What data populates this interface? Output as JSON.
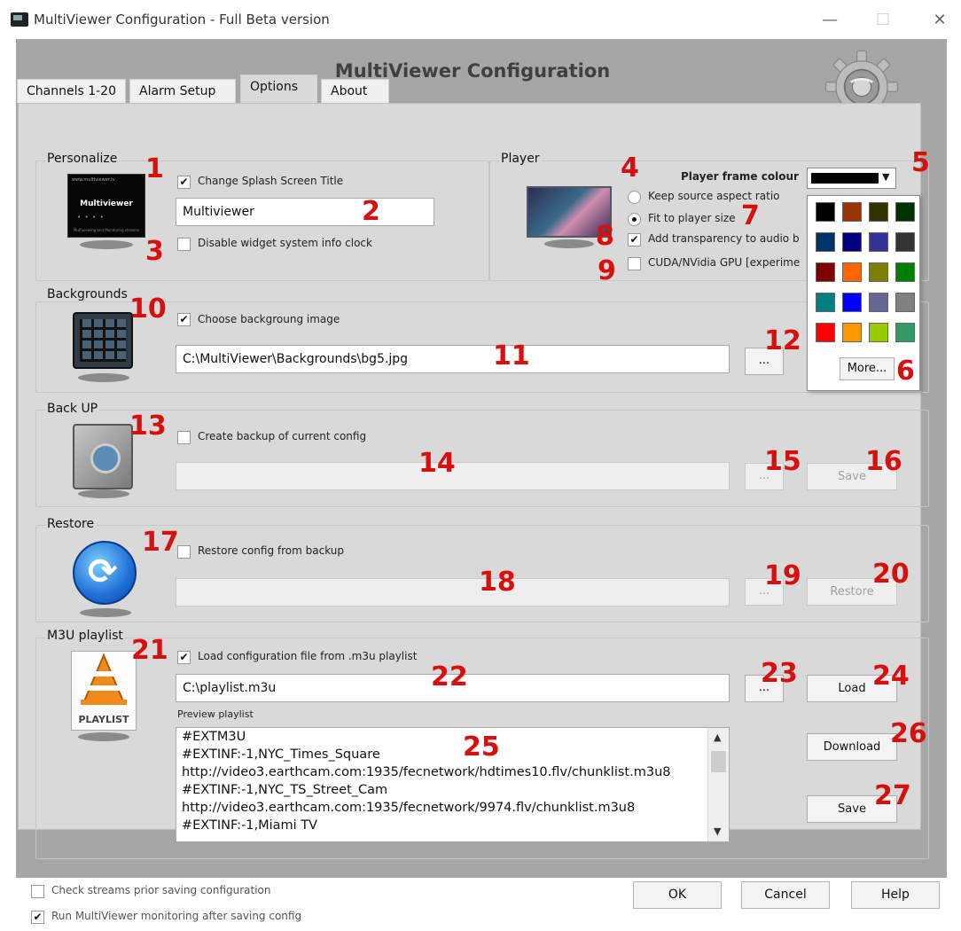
{
  "window": {
    "title": "MultiViewer Configuration - Full Beta version",
    "minimize_glyph": "—",
    "maximize_glyph": "☐",
    "close_glyph": "✕"
  },
  "header": {
    "title": "MultiViewer Configuration",
    "icon": "gear-icon"
  },
  "tabs": [
    {
      "label": "Channels 1-20",
      "active": false
    },
    {
      "label": "Alarm Setup",
      "active": false
    },
    {
      "label": "Options",
      "active": true
    },
    {
      "label": "About",
      "active": false
    }
  ],
  "personalize": {
    "group_label": "Personalize",
    "splash_thumb": {
      "top_text": "www.multiviewer.tv",
      "brand": "Multiviewer",
      "tagline": "Multiviewing and Monitoring streams"
    },
    "change_splash_label": "Change Splash Screen Title",
    "change_splash_checked": true,
    "splash_title_value": "Multiviewer",
    "disable_clock_label": "Disable widget system info clock",
    "disable_clock_checked": false
  },
  "player": {
    "group_label": "Player",
    "frame_colour_label": "Player frame colour",
    "frame_colour": "#000000",
    "keep_aspect_label": "Keep source aspect ratio",
    "fit_player_label": "Fit to player size",
    "selected_option": "fit",
    "transparency_label": "Add transparency to audio b",
    "transparency_checked": true,
    "cuda_label": "CUDA/NVidia GPU [experime",
    "cuda_checked": false
  },
  "palette": {
    "colors": [
      "#000000",
      "#993300",
      "#333300",
      "#003300",
      "#003366",
      "#000080",
      "#333399",
      "#333333",
      "#800000",
      "#FF6600",
      "#808000",
      "#008000",
      "#008080",
      "#0000FF",
      "#666699",
      "#808080",
      "#FF0000",
      "#FF9900",
      "#99CC00",
      "#339966"
    ],
    "more_label": "More..."
  },
  "backgrounds": {
    "group_label": "Backgrounds",
    "choose_label": "Choose backgroung image",
    "choose_checked": true,
    "path_value": "C:\\MultiViewer\\Backgrounds\\bg5.jpg",
    "browse_label": "..."
  },
  "backup": {
    "group_label": "Back UP",
    "create_label": "Create backup of current config",
    "create_checked": false,
    "path_value": "",
    "browse_label": "...",
    "save_label": "Save"
  },
  "restore": {
    "group_label": "Restore",
    "restore_label": "Restore config from backup",
    "restore_checked": false,
    "path_value": "",
    "browse_label": "...",
    "restore_button_label": "Restore"
  },
  "m3u": {
    "group_label": "M3U playlist",
    "icon_caption": "PLAYLIST",
    "load_from_label": "Load configuration file from .m3u playlist",
    "load_from_checked": true,
    "path_value": "C:\\playlist.m3u",
    "browse_label": "...",
    "load_label": "Load",
    "preview_label": "Preview playlist",
    "download_label": "Download",
    "save_label": "Save",
    "preview_lines": [
      "#EXTM3U",
      "#EXTINF:-1,NYC_Times_Square",
      "http://video3.earthcam.com:1935/fecnetwork/hdtimes10.flv/chunklist.m3u8",
      "#EXTINF:-1,NYC_TS_Street_Cam",
      "http://video3.earthcam.com:1935/fecnetwork/9974.flv/chunklist.m3u8",
      "#EXTINF:-1,Miami TV"
    ]
  },
  "footer": {
    "check_streams_label": "Check streams prior saving configuration",
    "check_streams_checked": false,
    "run_monitoring_label": "Run MultiViewer monitoring after saving config",
    "run_monitoring_checked": true,
    "ok_label": "OK",
    "cancel_label": "Cancel",
    "help_label": "Help"
  },
  "annotations": [
    "1",
    "2",
    "3",
    "4",
    "5",
    "6",
    "7",
    "8",
    "9",
    "10",
    "11",
    "12",
    "13",
    "14",
    "15",
    "16",
    "17",
    "18",
    "19",
    "20",
    "21",
    "22",
    "23",
    "24",
    "25",
    "26",
    "27"
  ]
}
